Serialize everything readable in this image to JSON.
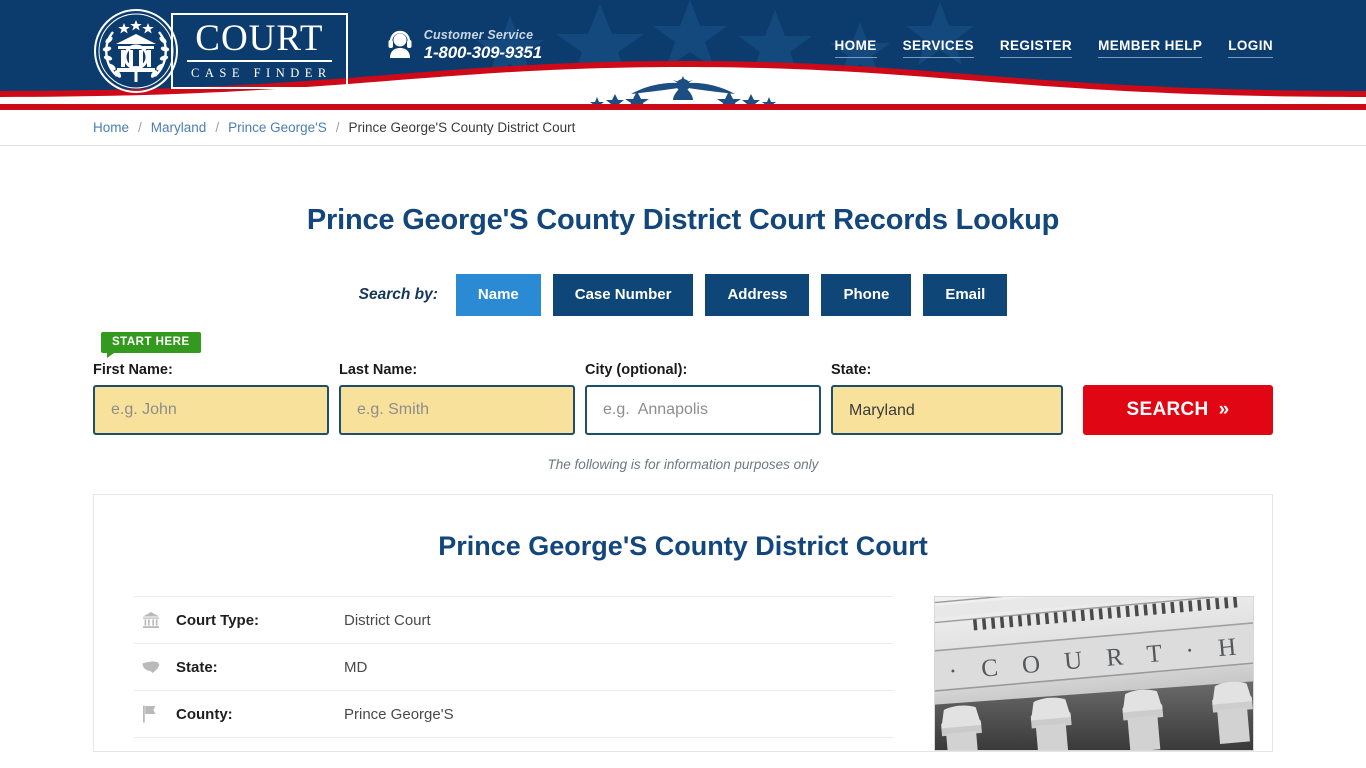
{
  "header": {
    "logo": {
      "emblem_icon": "court-seal-icon",
      "word_main": "COURT",
      "word_sub": "CASE FINDER"
    },
    "customer_service": {
      "icon": "headset-support-icon",
      "label": "Customer Service",
      "phone": "1-800-309-9351"
    },
    "nav": [
      {
        "label": "HOME"
      },
      {
        "label": "SERVICES"
      },
      {
        "label": "REGISTER"
      },
      {
        "label": "MEMBER HELP"
      },
      {
        "label": "LOGIN"
      }
    ],
    "colors": {
      "navy": "#0c3c6e",
      "red": "#cf0a18"
    },
    "emblem_icon": "eagle-banner-icon"
  },
  "breadcrumb": {
    "items": [
      {
        "label": "Home",
        "current": false
      },
      {
        "label": "Maryland",
        "current": false
      },
      {
        "label": "Prince George'S",
        "current": false
      },
      {
        "label": "Prince George'S County District Court",
        "current": true
      }
    ],
    "separator": "/"
  },
  "page": {
    "title": "Prince George'S County District Court Records Lookup",
    "disclaimer": "The following is for information purposes only"
  },
  "search": {
    "search_by_label": "Search by:",
    "tabs": [
      {
        "label": "Name",
        "active": true
      },
      {
        "label": "Case Number",
        "active": false
      },
      {
        "label": "Address",
        "active": false
      },
      {
        "label": "Phone",
        "active": false
      },
      {
        "label": "Email",
        "active": false
      }
    ],
    "start_here_badge": "START HERE",
    "fields": {
      "first_name": {
        "label": "First Name:",
        "value": "",
        "placeholder": "e.g. John"
      },
      "last_name": {
        "label": "Last Name:",
        "value": "",
        "placeholder": "e.g. Smith"
      },
      "city": {
        "label": "City (optional):",
        "value": "",
        "placeholder": "e.g.  Annapolis"
      },
      "state": {
        "label": "State:",
        "value": "Maryland",
        "options": [
          "Maryland"
        ]
      }
    },
    "button": {
      "label": "SEARCH",
      "chevron": "»"
    },
    "colors": {
      "active_tab": "#2b8ad4",
      "tab": "#0e4777",
      "field_highlight": "#f8e29b",
      "search_button": "#e00614",
      "badge_green": "#339a1e"
    }
  },
  "court_card": {
    "title": "Prince George'S County District Court",
    "rows": [
      {
        "icon": "bank-building-icon",
        "key": "Court Type:",
        "value": "District Court"
      },
      {
        "icon": "us-map-icon",
        "key": "State:",
        "value": "MD"
      },
      {
        "icon": "flag-icon",
        "key": "County:",
        "value": "Prince George'S"
      }
    ],
    "photo": {
      "icon": "courthouse-photo",
      "caption_text": "COURT HOUSE"
    }
  }
}
